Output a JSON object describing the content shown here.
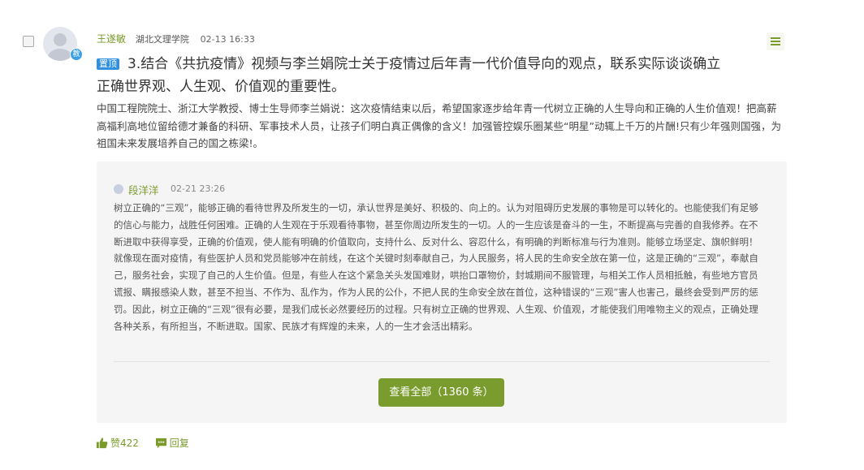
{
  "post": {
    "author": "王遂敏",
    "school": "湖北文理学院",
    "time": "02-13 16:33",
    "role_badge": "教",
    "top_badge": "置顶",
    "title": "3.结合《共抗疫情》视频与李兰娟院士关于疫情过后年青一代价值导向的观点，联系实际谈谈确立正确世界观、人生观、价值观的重要性。",
    "description": "中国工程院院士、浙江大学教授、博士生导师李兰娟说：这次疫情结束以后，希望国家逐步给年青一代树立正确的人生导向和正确的人生价值观！把高薪高福利高地位留给德才兼备的科研、军事技术人员，让孩子们明白真正偶像的含义！加强管控娱乐圈某些“明星”动辄上千万的片酬!只有少年强则国强，为祖国未来发展培养自己的国之栋梁!。"
  },
  "reply": {
    "author": "段洋洋",
    "time": "02-21 23:26",
    "text": "树立正确的“三观”，能够正确的看待世界及所发生的一切，承认世界是美好、积极的、向上的。认为对阻碍历史发展的事物是可以转化的。也能使我们有足够的信心与能力，战胜任何困难。正确的人生观在于乐观看待事物，甚至你周边所发生的一切。人的一生应该是奋斗的一生，不断提高与完善的自我修养。在不断进取中获得享受，正确的价值观，使人能有明确的价值取向，支持什么、反对什么、容忍什么，有明确的判断标准与行为准则。能够立场坚定、旗帜鲜明！就像现在面对疫情，有些医护人员和党员能够冲在前线，在这个关键时刻奉献自己，为人民服务，将人民的生命安全放在第一位，这是正确的“三观”，奉献自己，服务社会，实现了自己的人生价值。但是，有些人在这个紧急关头发国难财，哄抬口罩物价，封城期间不服管理，与相关工作人员相抵触，有些地方官员谎报、瞒报感染人数，甚至不担当、不作为、乱作为，作为人民的公仆，不把人民的生命安全放在首位，这种错误的“三观”害人也害己，最终会受到严厉的惩罚。因此，树立正确的“三观”很有必要，是我们成长必然要经历的过程。只有树立正确的世界观、人生观、价值观，才能使我们用唯物主义的观点，正确处理各种关系，有所担当，不断进取。国家、民族才有辉煌的未来，人的一生才会活出精彩。"
  },
  "view_all_label": "查看全部（1360 条）",
  "actions": {
    "like_label": "赞422",
    "reply_label": "回复"
  },
  "colors": {
    "accent_green": "#7a9a2a",
    "button_green": "#7a9c2e",
    "badge_blue": "#2f8fe0"
  },
  "icons": [
    "checkbox",
    "avatar",
    "menu-icon",
    "thumbs-up-icon",
    "chat-bubble-icon"
  ]
}
